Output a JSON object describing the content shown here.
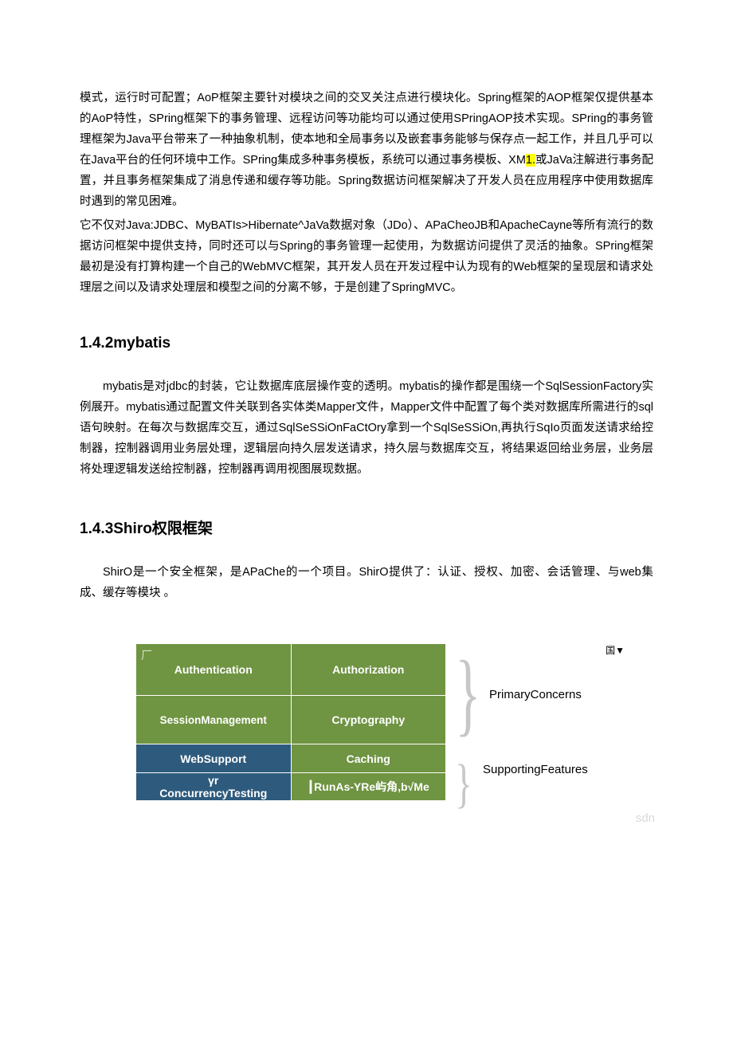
{
  "paragraphs": {
    "p1": "模式，运行时可配置；AoP框架主要针对模块之间的交叉关注点进行模块化。Spring框架的AOP框架仅提供基本的AoP特性，SPring框架下的事务管理、远程访问等功能均可以通过使用SPringAOP技术实现。SPring的事务管理框架为Java平台带来了一种抽象机制，使本地和全局事务以及嵌套事务能够与保存点一起工作，并且几乎可以在Java平台的任何环境中工作。SPring集成多种事务模板，系统可以通过事务模板、XM",
    "p1_hl": "1.",
    "p1b": "或JaVa注解进行事务配置，并且事务框架集成了消息传递和缓存等功能。Spring数据访问框架解决了开发人员在应用程序中使用数据库时遇到的常见困难。",
    "p2": "它不仅对Java:JDBC、MyBATIs>Hibernate^JaVa数据对象（JDo）、APaCheoJB和ApacheCayne等所有流行的数据访问框架中提供支持，同时还可以与Spring的事务管理一起使用，为数据访问提供了灵活的抽象。SPring框架最初是没有打算构建一个自己的WebMVC框架，其开发人员在开发过程中认为现有的Web框架的呈现层和请求处理层之间以及请求处理层和模型之间的分离不够，于是创建了SpringMVC。"
  },
  "sections": {
    "s142": "1.4.2mybatis",
    "s143": "1.4.3Shiro权限框架"
  },
  "mybatis_para": "mybatis是对jdbc的封装，它让数据库底层操作变的透明。mybatis的操作都是围绕一个SqlSessionFactory实例展开。mybatis通过配置文件关联到各实体类Mapper文件，Mapper文件中配置了每个类对数据库所需进行的sql语句映射。在每次与数据库交互，通过SqlSeSSiOnFaCtOry拿到一个SqlSeSSiOn,再执行SqIo页面发送请求给控制器，控制器调用业务层处理，逻辑层向持久层发送请求，持久层与数据库交互，将结果返回给业务层，业务层将处理逻辑发送给控制器，控制器再调用视图展现数据。",
  "shiro_para": "ShirO是一个安全框架，是APaChe的一个项目。ShirO提供了：认证、授权、加密、会话管理、与web集成、缓存等模块                           。",
  "diagram": {
    "cells": {
      "auth": "Authentication",
      "authz": "Authorization",
      "session": "SessionManagement",
      "crypt": "Cryptography",
      "web": "WebSupport",
      "cache": "Caching",
      "conc_top": "γr",
      "conc": "ConcurrencyTesting",
      "runas": "┃RunAs-YRe屿角,b√Me"
    },
    "labels": {
      "corner": "国▼",
      "primary": "PrimaryConcerns",
      "support": "SupportingFeatures",
      "watermark": "sdn"
    },
    "corner_mark": "厂"
  }
}
